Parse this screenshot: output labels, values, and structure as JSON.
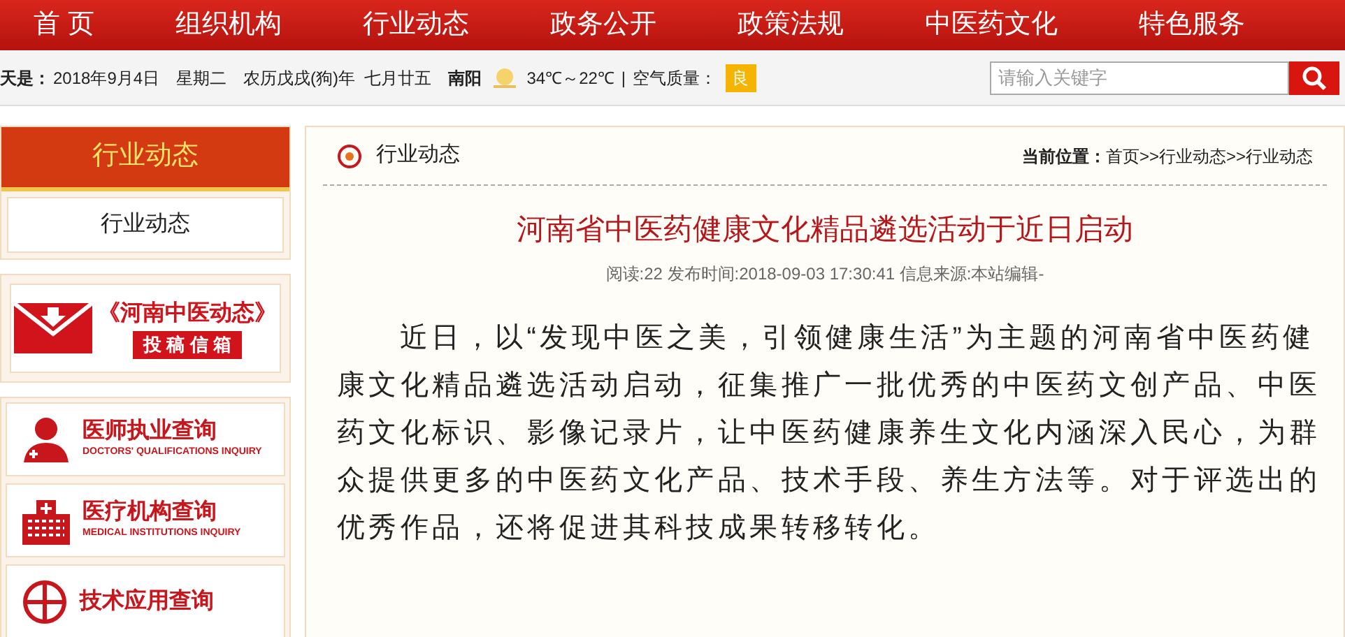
{
  "nav": [
    {
      "label": "首 页"
    },
    {
      "label": "组织机构"
    },
    {
      "label": "行业动态"
    },
    {
      "label": "政务公开"
    },
    {
      "label": "政策法规"
    },
    {
      "label": "中医药文化"
    },
    {
      "label": "特色服务"
    }
  ],
  "info_bar": {
    "today_label": "天是：",
    "date": "2018年9月4日",
    "weekday": "星期二",
    "lunar": "农历戊戌(狗)年  七月廿五",
    "city": "南阳",
    "temperature": "34℃～22℃",
    "separator": "|",
    "air_label": "空气质量：",
    "air_quality": "良"
  },
  "search": {
    "placeholder": "请输入关键字"
  },
  "sidebar": {
    "title": "行业动态",
    "items": [
      {
        "label": "行业动态"
      }
    ],
    "banner": {
      "title": "《河南中医动态》",
      "subtitle": "投 稿 信 箱"
    },
    "queries": [
      {
        "kind": "doctor",
        "title": "医师执业查询",
        "subtitle": "DOCTORS' QUALIFICATIONS INQUIRY"
      },
      {
        "kind": "hospital",
        "title": "医疗机构查询",
        "subtitle": "MEDICAL INSTITUTIONS INQUIRY"
      },
      {
        "kind": "globe",
        "title": "技术应用查询"
      }
    ]
  },
  "content": {
    "section_title": "行业动态",
    "breadcrumb_label": "当前位置：",
    "breadcrumb": "首页>>行业动态>>行业动态",
    "article_title": "河南省中医药健康文化精品遴选活动于近日启动",
    "meta": "阅读:22 发布时间:2018-09-03 17:30:41 信息来源:本站编辑-",
    "paragraph": "近日，以“发现中医之美，引领健康生活”为主题的河南省中医药健康文化精品遴选活动启动，征集推广一批优秀的中医药文创产品、中医药文化标识、影像记录片，让中医药健康养生文化内涵深入民心，为群众提供更多的中医药文化产品、技术手段、养生方法等。对于评选出的优秀作品，还将促进其科技成果转移转化。"
  }
}
